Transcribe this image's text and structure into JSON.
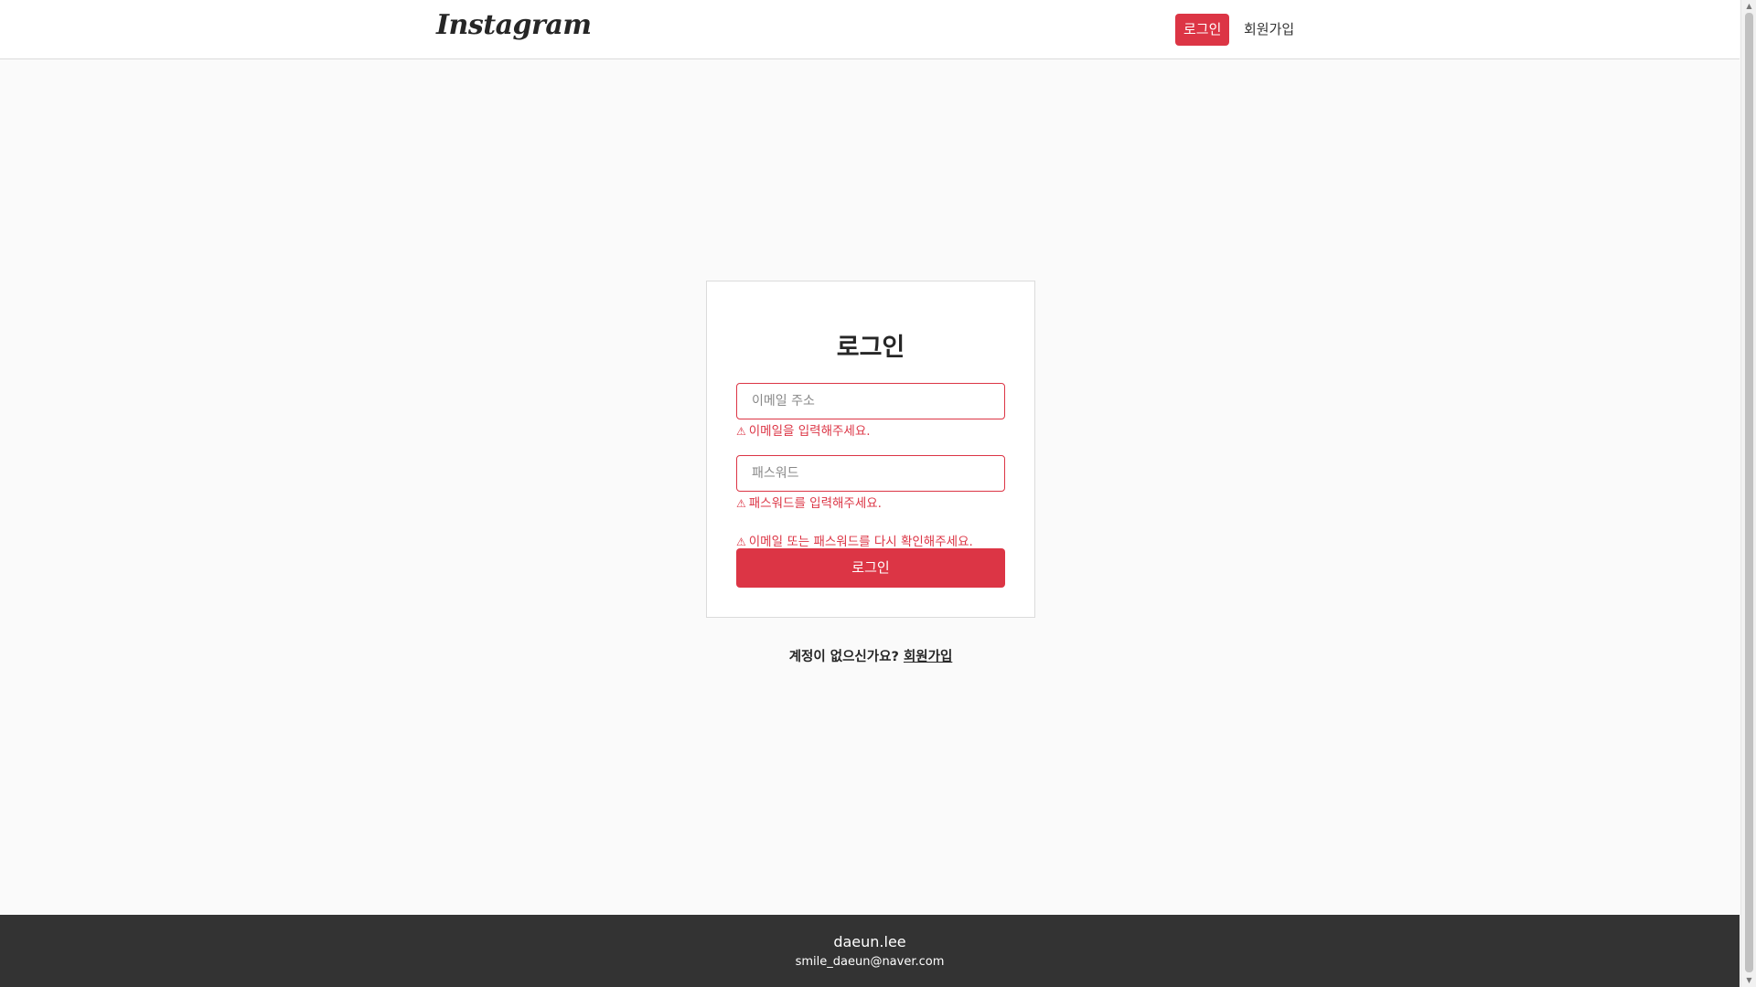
{
  "header": {
    "logo": "Instagram",
    "nav_login": "로그인",
    "nav_signup": "회원가입"
  },
  "login_card": {
    "title": "로그인",
    "email_placeholder": "이메일 주소",
    "email_error": "이메일을 입력해주세요.",
    "password_placeholder": "패스워드",
    "password_error": "패스워드를 입력해주세요.",
    "form_error": "이메일 또는 패스워드를 다시 확인해주세요.",
    "submit_label": "로그인",
    "warning_glyph": "⚠"
  },
  "signup_prompt": {
    "text": "계정이 없으신가요?",
    "link": "회원가입"
  },
  "footer": {
    "name": "daeun.lee",
    "email": "smile_daeun@naver.com"
  },
  "colors": {
    "accent": "#dc3545",
    "footer_bg": "#333333",
    "page_bg": "#fafafa"
  }
}
